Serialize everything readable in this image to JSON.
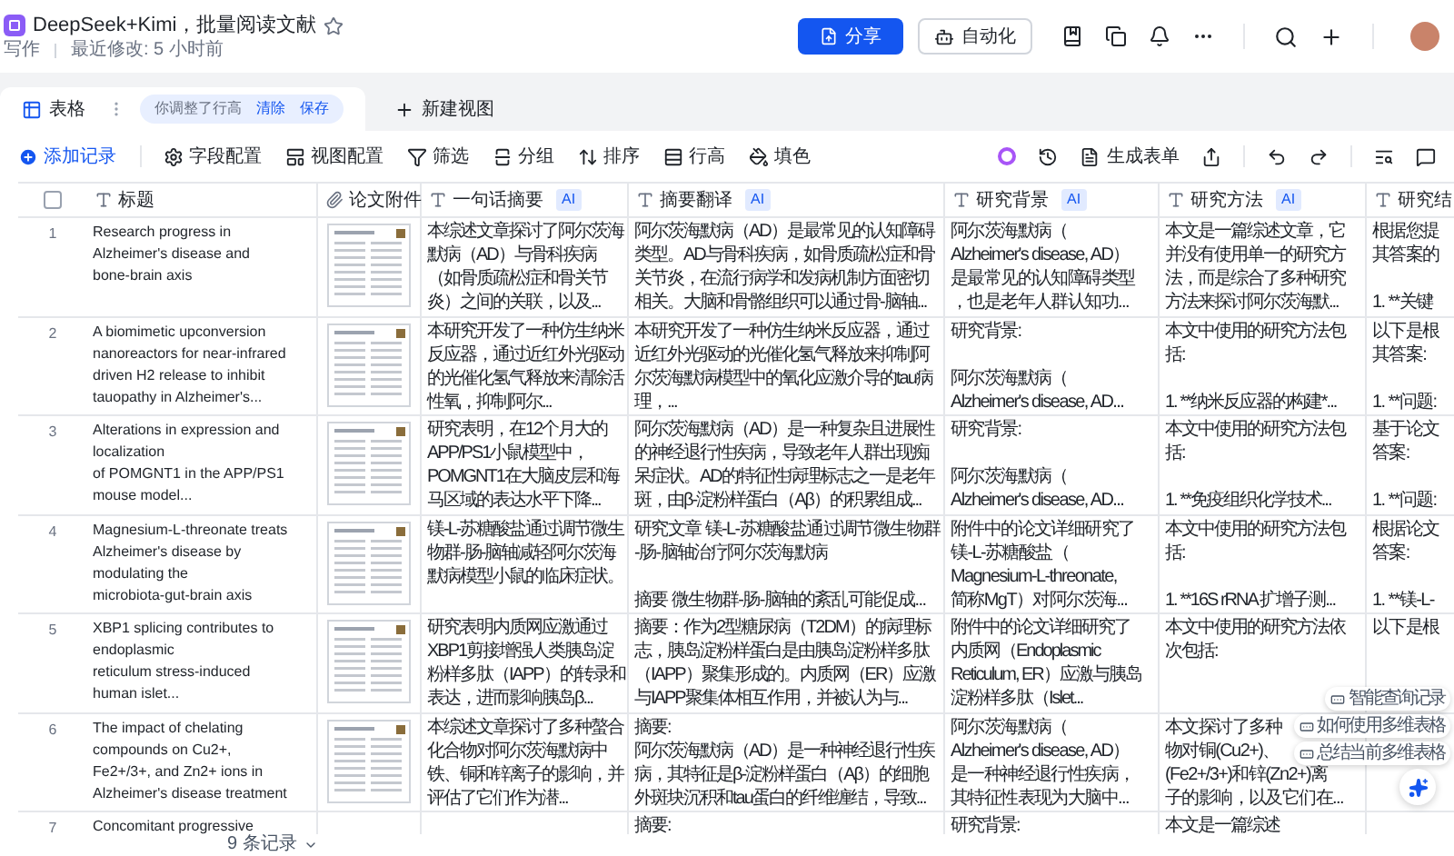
{
  "document": {
    "title": "DeepSeek+Kimi，批量阅读文献",
    "category": "写作",
    "last_modified": "最近修改: 5 小时前"
  },
  "header_buttons": {
    "share": "分享",
    "automation": "自动化"
  },
  "view_tabs": [
    {
      "label": "表格",
      "selected": true
    }
  ],
  "row_height_notice": {
    "text": "你调整了行高",
    "clear": "清除",
    "save": "保存"
  },
  "new_view": "新建视图",
  "toolbar": [
    {
      "label": "添加记录",
      "kind": "primary"
    },
    {
      "label": "字段配置",
      "kind": "normal"
    },
    {
      "label": "视图配置",
      "kind": "normal"
    },
    {
      "label": "筛选",
      "kind": "normal"
    },
    {
      "label": "分组",
      "kind": "normal"
    },
    {
      "label": "排序",
      "kind": "normal"
    },
    {
      "label": "行高",
      "kind": "normal"
    },
    {
      "label": "填色",
      "kind": "normal"
    }
  ],
  "generate_form": "生成表单",
  "select_all": {
    "checked": false
  },
  "columns": [
    {
      "label": "标题",
      "kind": "text"
    },
    {
      "label": "论文附件",
      "kind": "attachment"
    },
    {
      "label": "一句话摘要",
      "kind": "text",
      "badge": "AI"
    },
    {
      "label": "摘要翻译",
      "kind": "text",
      "badge": "AI"
    },
    {
      "label": "研究背景",
      "kind": "text",
      "badge": "AI"
    },
    {
      "label": "研究方法",
      "kind": "text",
      "badge": "AI"
    },
    {
      "label": "研究结",
      "kind": "text"
    }
  ],
  "rows": [
    {
      "number": "1",
      "title": "Research progress in\nAlzheimer's disease and\nbone-brain axis",
      "summary": "本综述文章探讨了阿尔茨海默病（AD）与骨科疾病（如骨质疏松症和骨关节炎）之间的关联，以及...",
      "translation": "阿尔茨海默病（AD）是最常见的认知障碍类型。AD与骨科疾病，如骨质疏松症和骨关节炎，在流行病学和发病机制方面密切相关。大脑和骨骼组织可以通过骨-脑轴...",
      "background": [
        [
          "阿尔茨海默病（",
          "Alzheimer's disease, AD）",
          "是最常见的认知障碍类型",
          "，也是老年人群认知功..."
        ]
      ],
      "method": "本文是一篇综述文章，它并没有使用单一的研究方法，而是综合了多种研究方法来探讨阿尔茨海默...",
      "column_7": [
        [
          "根据您提",
          "其答案的"
        ],
        [
          "1. **关键"
        ]
      ]
    },
    {
      "number": "2",
      "title": "A biomimetic upconversion\nnanoreactors for near-infrared\ndriven H2 release to inhibit\ntauopathy in Alzheimer's...",
      "summary": "本研究开发了一种仿生纳米反应器，通过近红外光驱动的光催化氢气释放来清除活性氧，抑制阿尔...",
      "translation": "本研究开发了一种仿生纳米反应器，通过近红外光驱动的光催化氢气释放来抑制阿尔茨海默病模型中的氧化应激介导的tau病理，...",
      "background": [
        [
          "研究背景:"
        ],
        [
          "阿尔茨海默病（",
          "Alzheimer's disease, AD..."
        ]
      ],
      "method": "本文中使用的研究方法包括:\n\n1. **纳米反应器的构建*...",
      "column_7": [
        [
          "以下是根",
          "其答案:"
        ],
        [
          "1. **问题:"
        ]
      ]
    },
    {
      "number": "3",
      "title": "Alterations in expression and\nlocalization\nof POMGNT1 in the APP/PS1\nmouse model...",
      "summary": "研究表明，在12个月大的APP/PS1小鼠模型中，POMGNT1在大脑皮层和海马区域的表达水平下降...",
      "translation": "阿尔茨海默病（AD）是一种复杂且进展性的神经退行性疾病，导致老年人群出现痴呆症状。AD的特征性病理标志之一是老年斑，由β-淀粉样蛋白（Aβ）的积累组成...",
      "background": [
        [
          "研究背景:"
        ],
        [
          "阿尔茨海默病（",
          "Alzheimer's disease, AD..."
        ]
      ],
      "method": "本文中使用的研究方法包括:\n\n1. **免疫组织化学技术...",
      "column_7": [
        [
          "基于论文",
          "答案:"
        ],
        [
          "1. **问题:"
        ]
      ]
    },
    {
      "number": "4",
      "title": "Magnesium-L-threonate treats\nAlzheimer's disease by\nmodulating the\nmicrobiota-gut-brain axis",
      "summary": "镁-L-苏糖酸盐通过调节微生物群-肠-脑轴减轻阿尔茨海默病模型小鼠的临床症状。",
      "translation": [
        [
          "研究文章 镁-L-苏糖酸盐通过调节微生物群",
          "-肠-脑轴治疗阿尔茨海默病"
        ],
        [
          "摘要 微生物群-肠-脑轴的紊乱可能促成..."
        ]
      ],
      "background": [
        [
          "附件中的论文详细研究了",
          "镁-L-苏糖酸盐（",
          "Magnesium-L-threonate,",
          "简称MgT）对阿尔茨海..."
        ]
      ],
      "method": "本文中使用的研究方法包括:\n\n1. **16S rRNA 扩增子测...",
      "column_7": [
        [
          "根据论文",
          "答案:"
        ],
        [
          "1. **镁-L-"
        ]
      ]
    },
    {
      "number": "5",
      "title": "XBP1 splicing contributes to\nendoplasmic\nreticulum stress-induced\nhuman islet...",
      "summary": "研究表明内质网应激通过XBP1剪接增强人类胰岛淀粉样多肽（IAPP）的转录和表达，进而影响胰岛β...",
      "translation": "摘要：作为2型糖尿病（T2DM）的病理标志，胰岛淀粉样蛋白是由胰岛淀粉样多肽（IAPP）聚集形成的。内质网（ER）应激与IAPP聚集体相互作用，并被认为与...",
      "background": "附件中的论文详细研究了内质网（Endoplasmic Reticulum, ER）应激与胰岛淀粉样多肽（Islet...",
      "method": "本文中使用的研究方法依次包括:",
      "column_7": [
        [
          "以下是根"
        ]
      ]
    },
    {
      "number": "6",
      "title": "The impact of chelating\ncompounds on Cu2+,\nFe2+/3+, and Zn2+ ions in\nAlzheimer's disease treatment",
      "summary": "本综述文章探讨了多种螯合化合物对阿尔茨海默病中铁、铜和锌离子的影响，并评估了它们作为潜...",
      "translation": "摘要:\n阿尔茨海默病（AD）是一种神经退行性疾病，其特征是β-淀粉样蛋白（Aβ）的细胞外斑块沉积和tau蛋白的纤维缠结，导致...",
      "background": [
        [
          "阿尔茨海默病（",
          "Alzheimer's disease, AD）",
          "是一种神经退行性疾病，",
          "其特征性表现为大脑中..."
        ]
      ],
      "method": [
        [
          "本文探讨了多种",
          "物对铜(Cu2+)、",
          "(Fe2+/3+)和锌(Zn2+)离",
          "子的影响，以及它们在..."
        ]
      ]
    },
    {
      "number": "7",
      "title": "Concomitant progressive",
      "translation": "摘要:",
      "background": "研究背景:",
      "method": "本文是一篇综述"
    }
  ],
  "footer": {
    "record_count": "9 条记录"
  },
  "assistant_menu": [
    "智能查询记录",
    "如何使用多维表格",
    "总结当前多维表格"
  ]
}
